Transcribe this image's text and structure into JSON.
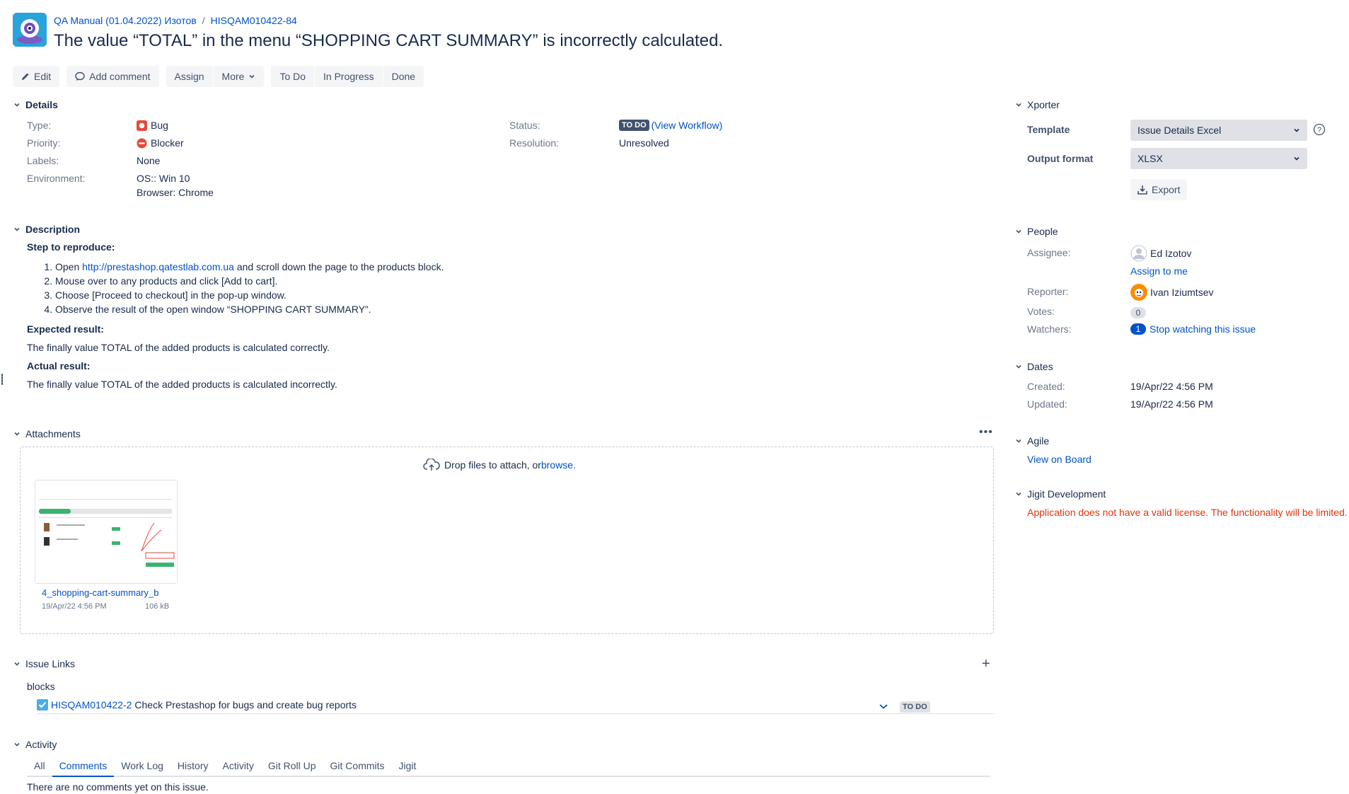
{
  "breadcrumb": {
    "project": "QA Manual (01.04.2022) Изотов",
    "separator": "/",
    "issue_key": "HISQAM010422-84"
  },
  "title": "The value “TOTAL” in the menu “SHOPPING CART SUMMARY” is incorrectly calculated.",
  "toolbar": {
    "edit": "Edit",
    "add_comment": "Add comment",
    "assign": "Assign",
    "more": "More",
    "todo": "To Do",
    "in_progress": "In Progress",
    "done": "Done"
  },
  "details": {
    "heading": "Details",
    "type_label": "Type:",
    "type_value": "Bug",
    "priority_label": "Priority:",
    "priority_value": "Blocker",
    "labels_label": "Labels:",
    "labels_value": "None",
    "environment_label": "Environment:",
    "environment_line1": "OS:: Win 10",
    "environment_line2": "Browser: Chrome",
    "status_label": "Status:",
    "status_value": "TO DO",
    "view_workflow": "(View Workflow)",
    "resolution_label": "Resolution:",
    "resolution_value": "Unresolved"
  },
  "description": {
    "heading": "Description",
    "steps_heading": "Step to reproduce:",
    "step1_pre": "Open ",
    "step1_link": "http://prestashop.qatestlab.com.ua",
    "step1_post": " and scroll down the page to the products block.",
    "step2": "Mouse over to any products and click [Add to cart].",
    "step3": "Choose [Proceed to checkout] in the pop-up window.",
    "step4": "Observe the result of the open window “SHOPPING CART SUMMARY”.",
    "expected_heading": "Expected result:",
    "expected_text": "The finally value TOTAL of the added products is calculated correctly.",
    "actual_heading": "Actual result:",
    "actual_text": "The finally value TOTAL of the added products is calculated incorrectly."
  },
  "attachments": {
    "heading": "Attachments",
    "drop_text": "Drop files to attach, or ",
    "browse": "browse.",
    "file_name": "4_shopping-cart-summary_b",
    "file_date": "19/Apr/22 4:56 PM",
    "file_size": "106 kB"
  },
  "issue_links": {
    "heading": "Issue Links",
    "relation": "blocks",
    "link_key": "HISQAM010422-2",
    "link_summary": "Check Prestashop for bugs and create bug reports",
    "link_status": "TO DO"
  },
  "activity": {
    "heading": "Activity",
    "tabs": [
      "All",
      "Comments",
      "Work Log",
      "History",
      "Activity",
      "Git Roll Up",
      "Git Commits",
      "Jigit"
    ],
    "active_tab": "Comments",
    "empty": "There are no comments yet on this issue."
  },
  "xporter": {
    "heading": "Xporter",
    "template_label": "Template",
    "template_value": "Issue Details Excel",
    "output_label": "Output format",
    "output_value": "XLSX",
    "export": "Export"
  },
  "people": {
    "heading": "People",
    "assignee_label": "Assignee:",
    "assignee_value": "Ed Izotov",
    "assign_to_me": "Assign to me",
    "reporter_label": "Reporter:",
    "reporter_value": "Ivan Iziumtsev",
    "votes_label": "Votes:",
    "votes_value": "0",
    "watchers_label": "Watchers:",
    "watchers_value": "1",
    "stop_watching": "Stop watching this issue"
  },
  "dates": {
    "heading": "Dates",
    "created_label": "Created:",
    "created_value": "19/Apr/22 4:56 PM",
    "updated_label": "Updated:",
    "updated_value": "19/Apr/22 4:56 PM"
  },
  "agile": {
    "heading": "Agile",
    "view_on_board": "View on Board"
  },
  "jigit": {
    "heading": "Jigit Development",
    "error": "Application does not have a valid license. The functionality will be limited."
  },
  "colors": {
    "link": "#0052cc",
    "error": "#de350b",
    "bug": "#e5493a",
    "blocker": "#e5493a"
  }
}
